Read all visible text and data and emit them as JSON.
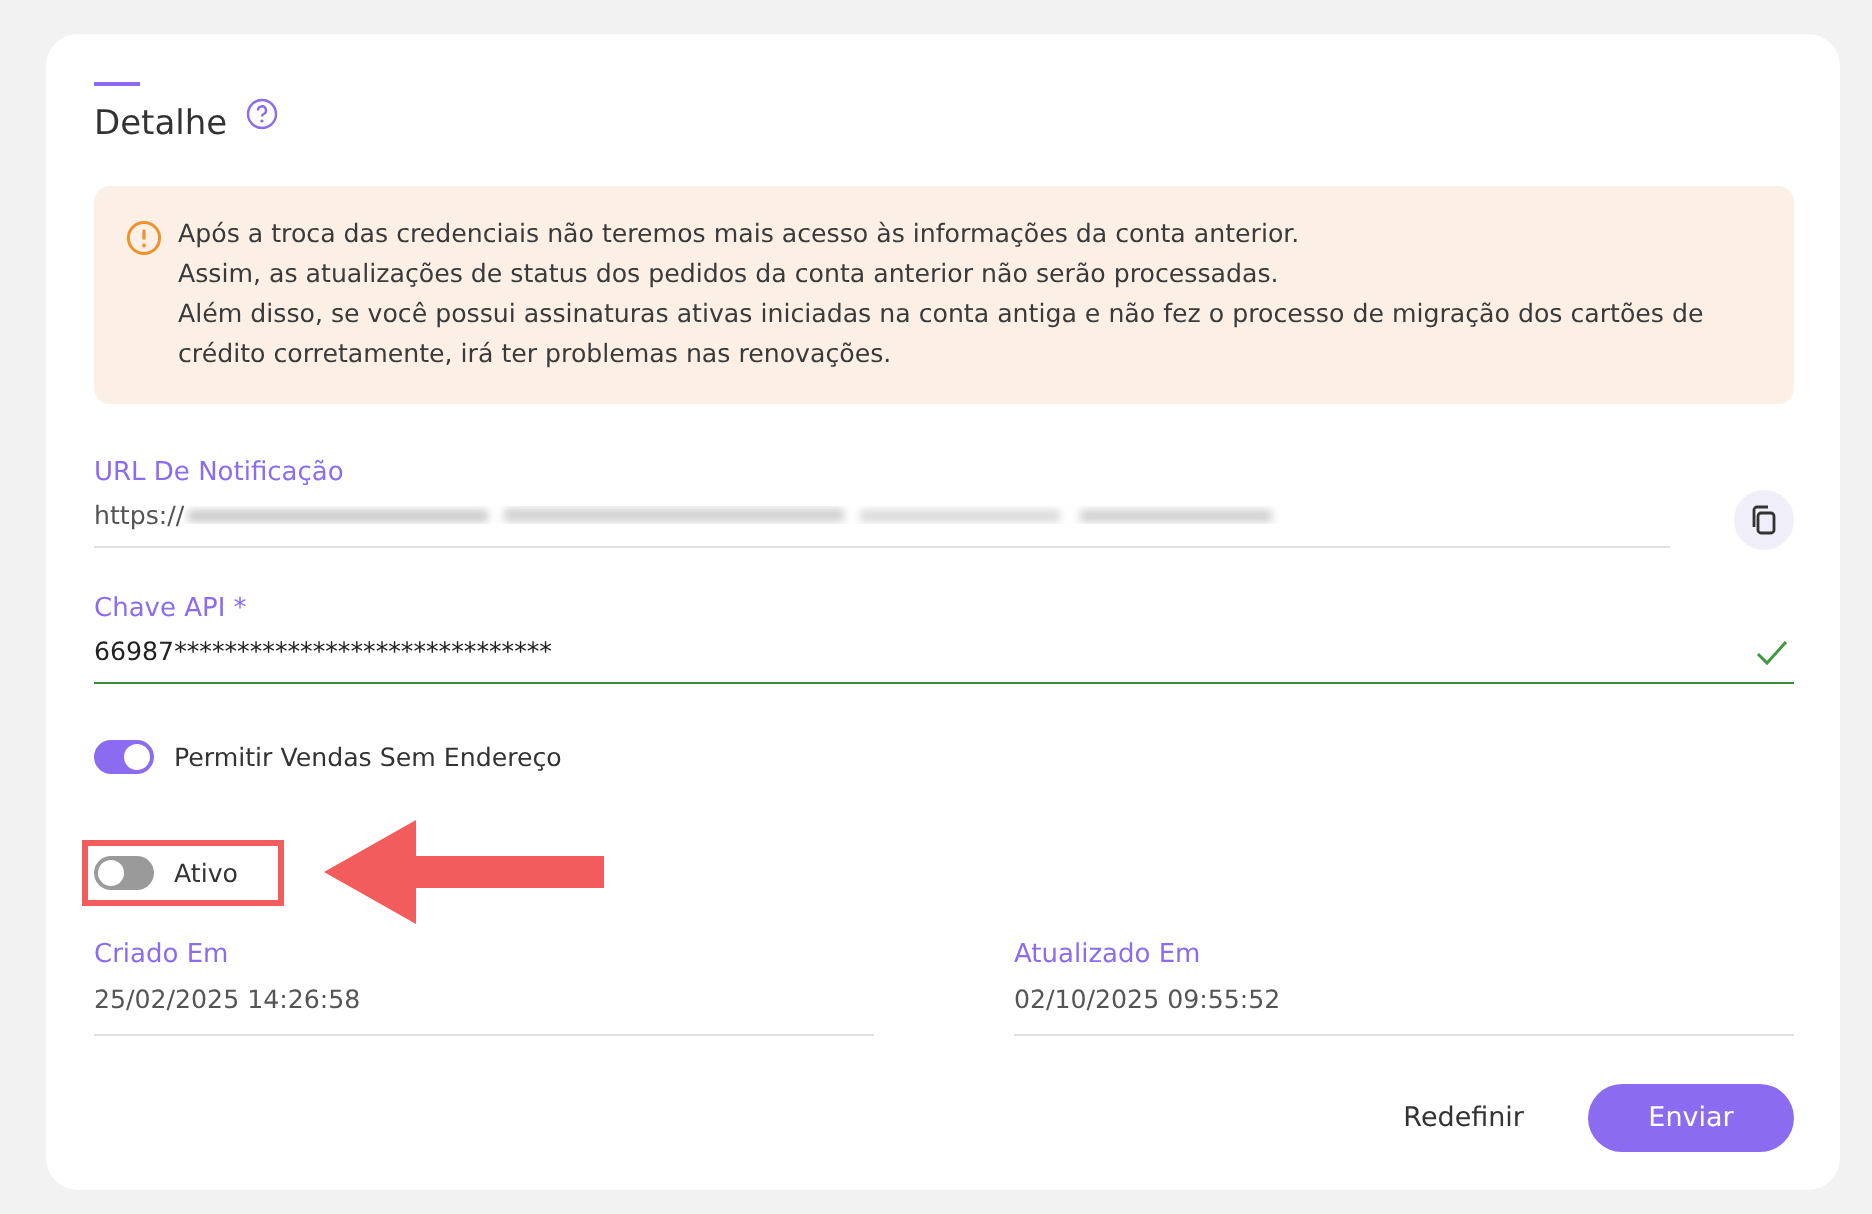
{
  "section": {
    "title": "Detalhe"
  },
  "alert": {
    "lines": [
      "Após a troca das credenciais não teremos mais acesso às informações da conta anterior.",
      "Assim, as atualizações de status dos pedidos da conta anterior não serão processadas.",
      "Além disso, se você possui assinaturas ativas iniciadas na conta antiga e não fez o processo de migração dos cartões de crédito corretamente, irá ter problemas nas renovações."
    ]
  },
  "url_field": {
    "label": "URL De Notificação",
    "value": "https://",
    "redacted": true
  },
  "api_key_field": {
    "label": "Chave API *",
    "value": "66987******************************",
    "valid": true
  },
  "toggles": [
    {
      "label": "Permitir Vendas Sem Endereço",
      "on": true,
      "highlighted": false
    },
    {
      "label": "Ativo",
      "on": false,
      "highlighted": true
    }
  ],
  "dates": [
    {
      "label": "Criado Em",
      "value": "25/02/2025 14:26:58"
    },
    {
      "label": "Atualizado Em",
      "value": "02/10/2025 09:55:52"
    }
  ],
  "buttons": [
    {
      "label": "Redefinir",
      "kind": "text"
    },
    {
      "label": "Enviar",
      "kind": "primary"
    }
  ]
}
